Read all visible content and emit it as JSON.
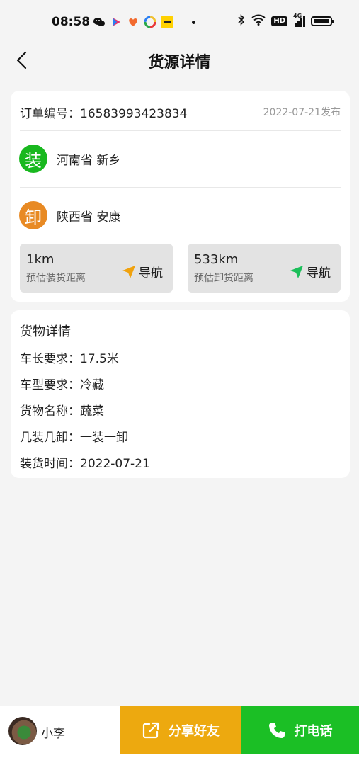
{
  "status_bar": {
    "time": "08:58",
    "hd_label": "HD",
    "network_label": "4G"
  },
  "header": {
    "title": "货源详情"
  },
  "order": {
    "label": "订单编号：16583993423834",
    "publish_date": "2022-07-21发布",
    "load": {
      "badge": "装",
      "place": "河南省 新乡",
      "color": "#19b81f"
    },
    "unload": {
      "badge": "卸",
      "place": "陕西省 安康",
      "color": "#e88a24"
    },
    "nav_load": {
      "distance": "1km",
      "sub": "预估装货距离",
      "action": "导航",
      "icon_color": "#f0a20e"
    },
    "nav_unload": {
      "distance": "533km",
      "sub": "预估卸货距离",
      "action": "导航",
      "icon_color": "#1bbf5a"
    }
  },
  "cargo": {
    "title": "货物详情",
    "items": [
      "车长要求：17.5米",
      "车型要求：冷藏",
      "货物名称：蔬菜",
      "几装几卸：一装一卸",
      "装货时间：2022-07-21"
    ]
  },
  "bottom": {
    "user_name": "小李",
    "share_label": "分享好友",
    "call_label": "打电话",
    "share_color": "#eda90f",
    "call_color": "#1bbf25"
  }
}
